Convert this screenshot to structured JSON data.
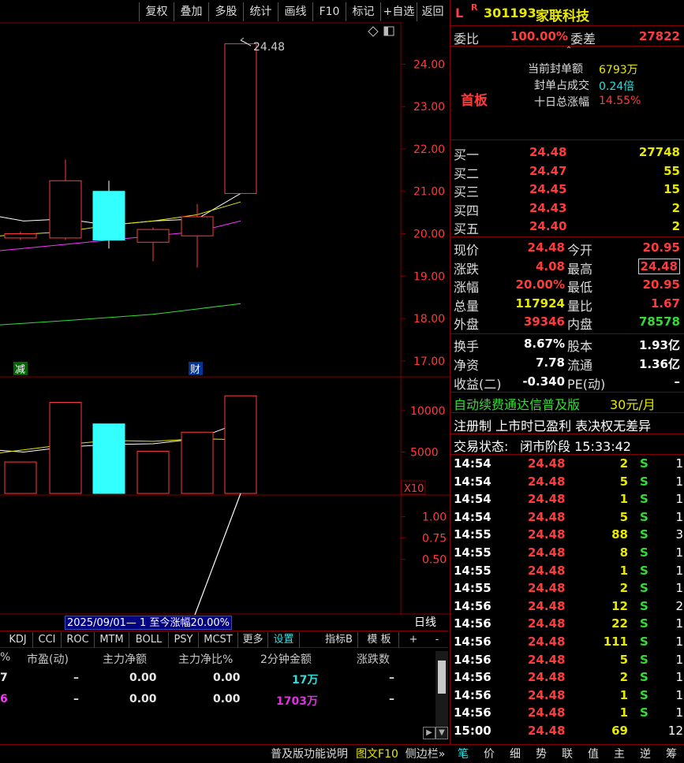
{
  "toolbar": {
    "buttons": [
      "复权",
      "叠加",
      "多股",
      "统计",
      "画线",
      "F10",
      "标记",
      "+自选",
      "返回"
    ]
  },
  "chart": {
    "price_axis": [
      "24.00",
      "23.00",
      "22.00",
      "21.00",
      "20.00",
      "19.00",
      "18.00",
      "17.00"
    ],
    "high_label": "24.48",
    "marker_jian": "减",
    "marker_cai": "财",
    "vol_axis": [
      "10000",
      "5000"
    ],
    "vol_unit": "X10",
    "ind_axis": [
      "1.00",
      "0.75",
      "0.50"
    ],
    "colors": {
      "up": "#ff3b3b",
      "down": "#33ffff",
      "ma1": "#ffffff",
      "ma2": "#e8e800",
      "ma3": "#ff33ff",
      "ma4": "#33dd33"
    }
  },
  "chart_data": {
    "type": "candlestick",
    "candles": [
      {
        "open": 20.0,
        "close": 19.9,
        "high": 20.05,
        "low": 19.85,
        "dir": "up"
      },
      {
        "open": 19.9,
        "close": 21.25,
        "high": 21.75,
        "low": 19.85,
        "dir": "up"
      },
      {
        "open": 21.0,
        "close": 19.85,
        "high": 21.25,
        "low": 19.65,
        "dir": "down"
      },
      {
        "open": 19.8,
        "close": 20.1,
        "high": 20.15,
        "low": 19.35,
        "dir": "up"
      },
      {
        "open": 19.95,
        "close": 20.4,
        "high": 20.7,
        "low": 19.2,
        "dir": "up"
      },
      {
        "open": 20.95,
        "close": 24.48,
        "high": 24.48,
        "low": 20.95,
        "dir": "up"
      }
    ],
    "volumes": [
      3800,
      11000,
      8400,
      5100,
      7400,
      11792
    ],
    "ylim": [
      16.7,
      24.9
    ]
  },
  "range_label": "2025/09/01— 1 至今涨幅20.00%",
  "period_label": "日线",
  "indicator_tabs": [
    "KDJ",
    "CCI",
    "ROC",
    "MTM",
    "BOLL",
    "PSY",
    "MCST",
    "更多",
    "设置",
    "指标B",
    "模 板",
    "+",
    "-"
  ],
  "bottom_table": {
    "headers": [
      "%",
      "市盈(动)",
      "主力净额",
      "主力净比%",
      "2分钟金额",
      "涨跌数"
    ],
    "rows": [
      {
        "c0": "7",
        "pe": "–",
        "net": "0.00",
        "ratio": "0.00",
        "amt": "17万",
        "chg": "–"
      },
      {
        "c0": "6",
        "pe": "–",
        "net": "0.00",
        "ratio": "0.00",
        "amt": "1703万",
        "chg": "–"
      }
    ]
  },
  "bottom_bar": [
    "普及版功能说明",
    "图文F10",
    "侧边栏»",
    "笔",
    "价",
    "细",
    "势",
    "联",
    "值",
    "主",
    "逆",
    "筹"
  ],
  "quote": {
    "l_flag": "L",
    "r_flag": "R",
    "code": "301193",
    "name": "家联科技",
    "weibi_label": "委比",
    "weibi": "100.00%",
    "weicha_label": "委差",
    "weicha": "27822",
    "board": "首板",
    "seal_amount_label": "当前封单额",
    "seal_amount": "6793万",
    "seal_ratio_label": "封单占成交",
    "seal_ratio": "0.24倍",
    "tenday_label": "十日总涨幅",
    "tenday": "14.55%",
    "bids": [
      {
        "label": "买一",
        "price": "24.48",
        "vol": "27748"
      },
      {
        "label": "买二",
        "price": "24.47",
        "vol": "55"
      },
      {
        "label": "买三",
        "price": "24.45",
        "vol": "15"
      },
      {
        "label": "买四",
        "price": "24.43",
        "vol": "2"
      },
      {
        "label": "买五",
        "price": "24.40",
        "vol": "2"
      }
    ],
    "stats": [
      {
        "l1": "现价",
        "v1": "24.48",
        "l2": "今开",
        "v2": "20.95"
      },
      {
        "l1": "涨跌",
        "v1": "4.08",
        "l2": "最高",
        "v2": "24.48"
      },
      {
        "l1": "涨幅",
        "v1": "20.00%",
        "l2": "最低",
        "v2": "20.95"
      },
      {
        "l1": "总量",
        "v1": "117924",
        "l2": "量比",
        "v2": "1.67"
      },
      {
        "l1": "外盘",
        "v1": "39346",
        "l2": "内盘",
        "v2": "78578"
      }
    ],
    "fund": [
      {
        "l1": "换手",
        "v1": "8.67%",
        "l2": "股本",
        "v2": "1.93亿"
      },
      {
        "l1": "净资",
        "v1": "7.78",
        "l2": "流通",
        "v2": "1.36亿"
      },
      {
        "l1": "收益(二)",
        "v1": "-0.340",
        "l2": "PE(动)",
        "v2": "–"
      }
    ],
    "promo": "自动续费通达信普及版",
    "promo_price": "30元/月",
    "notice": "注册制 上市时已盈利 表决权无差异",
    "state_label": "交易状态:",
    "state": "闭市阶段 15:33:42"
  },
  "ticks": [
    {
      "t": "14:54",
      "p": "24.48",
      "v": "2",
      "s": "S",
      "n": "1"
    },
    {
      "t": "14:54",
      "p": "24.48",
      "v": "5",
      "s": "S",
      "n": "1"
    },
    {
      "t": "14:54",
      "p": "24.48",
      "v": "1",
      "s": "S",
      "n": "1"
    },
    {
      "t": "14:54",
      "p": "24.48",
      "v": "5",
      "s": "S",
      "n": "1"
    },
    {
      "t": "14:55",
      "p": "24.48",
      "v": "88",
      "s": "S",
      "n": "3"
    },
    {
      "t": "14:55",
      "p": "24.48",
      "v": "8",
      "s": "S",
      "n": "1"
    },
    {
      "t": "14:55",
      "p": "24.48",
      "v": "1",
      "s": "S",
      "n": "1"
    },
    {
      "t": "14:55",
      "p": "24.48",
      "v": "2",
      "s": "S",
      "n": "1"
    },
    {
      "t": "14:56",
      "p": "24.48",
      "v": "12",
      "s": "S",
      "n": "2"
    },
    {
      "t": "14:56",
      "p": "24.48",
      "v": "22",
      "s": "S",
      "n": "1"
    },
    {
      "t": "14:56",
      "p": "24.48",
      "v": "111",
      "s": "S",
      "n": "1"
    },
    {
      "t": "14:56",
      "p": "24.48",
      "v": "5",
      "s": "S",
      "n": "1"
    },
    {
      "t": "14:56",
      "p": "24.48",
      "v": "2",
      "s": "S",
      "n": "1"
    },
    {
      "t": "14:56",
      "p": "24.48",
      "v": "1",
      "s": "S",
      "n": "1"
    },
    {
      "t": "14:56",
      "p": "24.48",
      "v": "1",
      "s": "S",
      "n": "1"
    },
    {
      "t": "15:00",
      "p": "24.48",
      "v": "69",
      "s": "",
      "n": "12"
    }
  ]
}
